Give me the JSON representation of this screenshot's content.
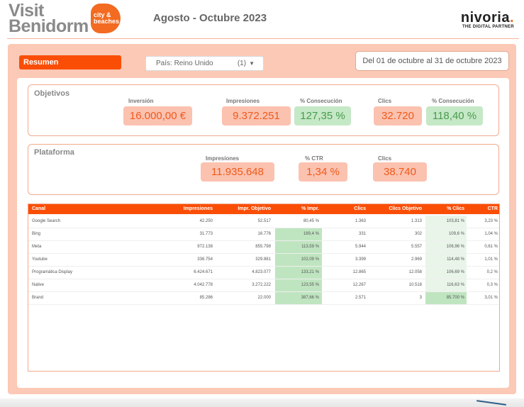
{
  "header": {
    "logo_line1": "Visit",
    "logo_line2": "Benidorm",
    "logo_badge_line1": "city &",
    "logo_badge_line2": "beaches",
    "period": "Agosto - Octubre 2023",
    "brand_name": "nivoria",
    "brand_dot": ".",
    "brand_tagline": "THE DIGITAL PARTNER"
  },
  "controls": {
    "summary_label": "Resumen",
    "country_label": "País: Reino Unido",
    "country_count": "(1)",
    "date_range": "Del 01 de octubre al 31 de octubre 2023"
  },
  "objetivos": {
    "title": "Objetivos",
    "inversion_label": "Inversión",
    "inversion_value": "16.000,00 €",
    "impresiones_label": "Impresiones",
    "impresiones_value": "9.372.251",
    "consecucion1_label": "% Consecución",
    "consecucion1_value": "127,35 %",
    "clics_label": "Clics",
    "clics_value": "32.720",
    "consecucion2_label": "% Consecución",
    "consecucion2_value": "118,40 %"
  },
  "plataforma": {
    "title": "Plataforma",
    "impresiones_label": "Impresiones",
    "impresiones_value": "11.935.648",
    "ctr_label": "% CTR",
    "ctr_value": "1,34 %",
    "clics_label": "Clics",
    "clics_value": "38.740"
  },
  "table": {
    "headers": [
      "Canal",
      "Impresiones",
      "Impr. Objetivo",
      "% Impr.",
      "Clics",
      "Clics Objetivo",
      "% Clics",
      "CTR"
    ],
    "rows": [
      [
        "Google Search",
        "42.250",
        "52.517",
        "80,45 %",
        "1.363",
        "1.313",
        "103,81 %",
        "3,23 %"
      ],
      [
        "Bing",
        "31.773",
        "16.776",
        "189,4 %",
        "331",
        "302",
        "109,6 %",
        "1,04 %"
      ],
      [
        "Meta",
        "972.138",
        "855.798",
        "113,59 %",
        "5.944",
        "5.557",
        "106,96 %",
        "0,61 %"
      ],
      [
        "Youtube",
        "336.754",
        "329.881",
        "102,09 %",
        "3.399",
        "2.969",
        "114,48 %",
        "1,01 %"
      ],
      [
        "Programática Display",
        "6.424.671",
        "4.823.077",
        "133,21 %",
        "12.865",
        "12.058",
        "106,69 %",
        "0,2 %"
      ],
      [
        "Native",
        "4.042.778",
        "3.272.222",
        "123,55 %",
        "12.267",
        "10.518",
        "116,63 %",
        "0,3 %"
      ],
      [
        "Brand",
        "85.286",
        "22.000",
        "387,66 %",
        "2.571",
        "3",
        "85.700 %",
        "3,01 %"
      ]
    ]
  }
}
